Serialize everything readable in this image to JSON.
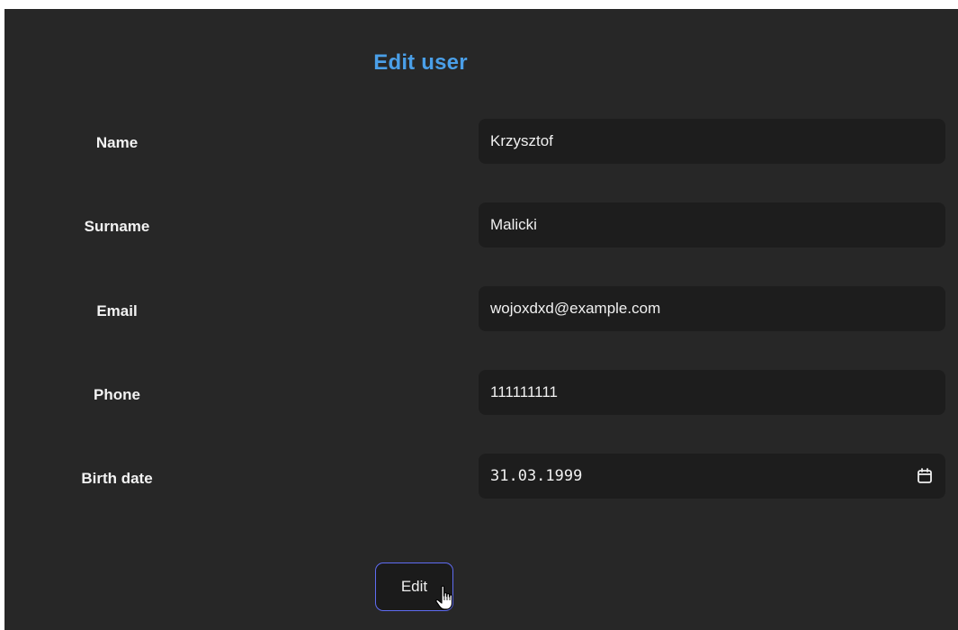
{
  "form": {
    "title": "Edit user",
    "fields": [
      {
        "label": "Name",
        "value": "Krzysztof"
      },
      {
        "label": "Surname",
        "value": "Malicki"
      },
      {
        "label": "Email",
        "value": "wojoxdxd@example.com"
      },
      {
        "label": "Phone",
        "value": "111111111"
      },
      {
        "label": "Birth date",
        "value": "31.03.1999"
      }
    ],
    "submit_label": "Edit"
  },
  "icons": {
    "date_picker": "calendar-icon",
    "cursor": "hand-pointer-cursor"
  },
  "colors": {
    "background": "#272727",
    "field_background": "#1d1d1d",
    "title": "#4a9fe8",
    "button_border": "#5f6cf2",
    "text": "#f0f0f0"
  }
}
